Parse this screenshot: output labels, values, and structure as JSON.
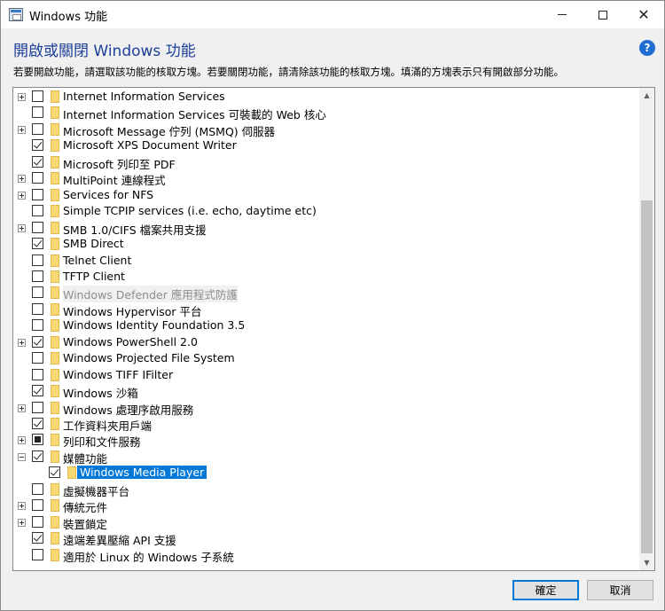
{
  "window": {
    "title": "Windows 功能",
    "controls": [
      "minimize-icon",
      "maximize-icon",
      "close-icon"
    ]
  },
  "header": {
    "heading": "開啟或關閉 Windows 功能",
    "description": "若要開啟功能，請選取該功能的核取方塊。若要關閉功能，請清除該功能的核取方塊。填滿的方塊表示只有開啟部分功能。",
    "help_icon": "?"
  },
  "features": [
    {
      "label": "Internet Information Services",
      "expander": "plus",
      "check": "unchecked",
      "level": 0
    },
    {
      "label": "Internet Information Services 可裝載的 Web 核心",
      "expander": "none",
      "check": "unchecked",
      "level": 0
    },
    {
      "label": "Microsoft Message 佇列 (MSMQ) 伺服器",
      "expander": "plus",
      "check": "unchecked",
      "level": 0
    },
    {
      "label": "Microsoft XPS Document Writer",
      "expander": "none",
      "check": "checked",
      "level": 0
    },
    {
      "label": "Microsoft 列印至 PDF",
      "expander": "none",
      "check": "checked",
      "level": 0
    },
    {
      "label": "MultiPoint 連線程式",
      "expander": "plus",
      "check": "unchecked",
      "level": 0
    },
    {
      "label": "Services for NFS",
      "expander": "plus",
      "check": "unchecked",
      "level": 0
    },
    {
      "label": "Simple TCPIP services (i.e. echo, daytime etc)",
      "expander": "none",
      "check": "unchecked",
      "level": 0
    },
    {
      "label": "SMB 1.0/CIFS 檔案共用支援",
      "expander": "plus",
      "check": "unchecked",
      "level": 0
    },
    {
      "label": "SMB Direct",
      "expander": "none",
      "check": "checked",
      "level": 0
    },
    {
      "label": "Telnet Client",
      "expander": "none",
      "check": "unchecked",
      "level": 0
    },
    {
      "label": "TFTP Client",
      "expander": "none",
      "check": "unchecked",
      "level": 0
    },
    {
      "label": "Windows Defender 應用程式防護",
      "expander": "none",
      "check": "unchecked",
      "level": 0,
      "disabled": true
    },
    {
      "label": "Windows Hypervisor 平台",
      "expander": "none",
      "check": "unchecked",
      "level": 0
    },
    {
      "label": "Windows Identity Foundation 3.5",
      "expander": "none",
      "check": "unchecked",
      "level": 0
    },
    {
      "label": "Windows PowerShell 2.0",
      "expander": "plus",
      "check": "checked",
      "level": 0
    },
    {
      "label": "Windows Projected File System",
      "expander": "none",
      "check": "unchecked",
      "level": 0
    },
    {
      "label": "Windows TIFF IFilter",
      "expander": "none",
      "check": "unchecked",
      "level": 0
    },
    {
      "label": "Windows 沙箱",
      "expander": "none",
      "check": "checked",
      "level": 0
    },
    {
      "label": "Windows 處理序啟用服務",
      "expander": "plus",
      "check": "unchecked",
      "level": 0
    },
    {
      "label": "工作資料夾用戶端",
      "expander": "none",
      "check": "checked",
      "level": 0
    },
    {
      "label": "列印和文件服務",
      "expander": "plus",
      "check": "partial",
      "level": 0
    },
    {
      "label": "媒體功能",
      "expander": "minus",
      "check": "checked",
      "level": 0
    },
    {
      "label": "Windows Media Player",
      "expander": "none",
      "check": "checked",
      "level": 1,
      "selected": true
    },
    {
      "label": "虛擬機器平台",
      "expander": "none",
      "check": "unchecked",
      "level": 0
    },
    {
      "label": "傳統元件",
      "expander": "plus",
      "check": "unchecked",
      "level": 0
    },
    {
      "label": "裝置鎖定",
      "expander": "plus",
      "check": "unchecked",
      "level": 0
    },
    {
      "label": "遠端差異壓縮 API 支援",
      "expander": "none",
      "check": "checked",
      "level": 0
    },
    {
      "label": "適用於 Linux 的 Windows 子系統",
      "expander": "none",
      "check": "unchecked",
      "level": 0
    }
  ],
  "buttons": {
    "ok_label": "確定",
    "cancel_label": "取消"
  },
  "colors": {
    "heading": "#1b3f9b",
    "selection": "#0078d7",
    "folder": "#f8d775"
  }
}
